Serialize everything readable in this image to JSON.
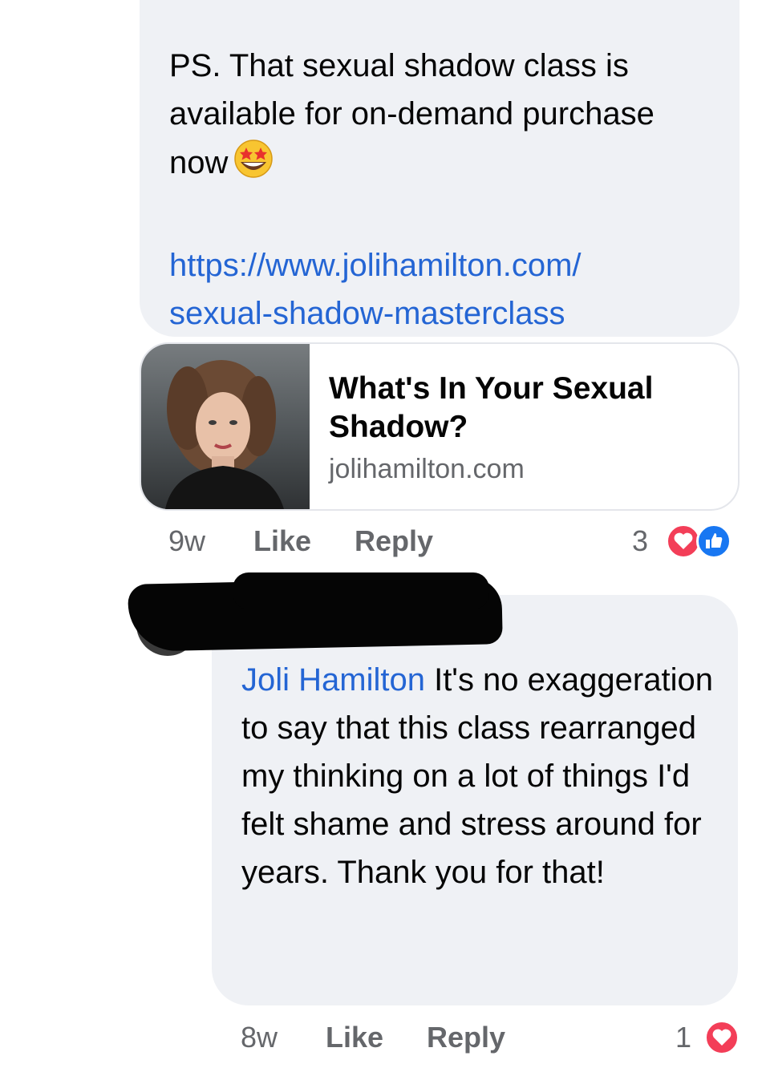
{
  "comment1": {
    "text": "PS. That sexual shadow class is available for on-demand purchase now",
    "emoji": "star-struck-emoji",
    "link_line1": "https://www.jolihamilton.com/",
    "link_line2": "sexual-shadow-masterclass",
    "preview": {
      "title": "What's In Your Sexual Shadow?",
      "domain": "jolihamilton.com"
    },
    "time": "9w",
    "like_label": "Like",
    "reply_label": "Reply",
    "reaction_count": "3",
    "reactions": [
      "heart-reaction-icon",
      "like-reaction-icon"
    ]
  },
  "comment2": {
    "author": "[redacted]",
    "mention": "Joli Hamilton",
    "text": " It's no exaggeration to say that this class rearranged my thinking on a lot of things I'd felt shame and stress around for years. Thank you for that!",
    "time": "8w",
    "like_label": "Like",
    "reply_label": "Reply",
    "reaction_count": "1",
    "reactions": [
      "heart-reaction-icon"
    ]
  },
  "colors": {
    "bubble": "#eff1f5",
    "link": "#2465d4",
    "meta": "#65676b",
    "heart": "#f33e58",
    "like": "#1877f2"
  }
}
